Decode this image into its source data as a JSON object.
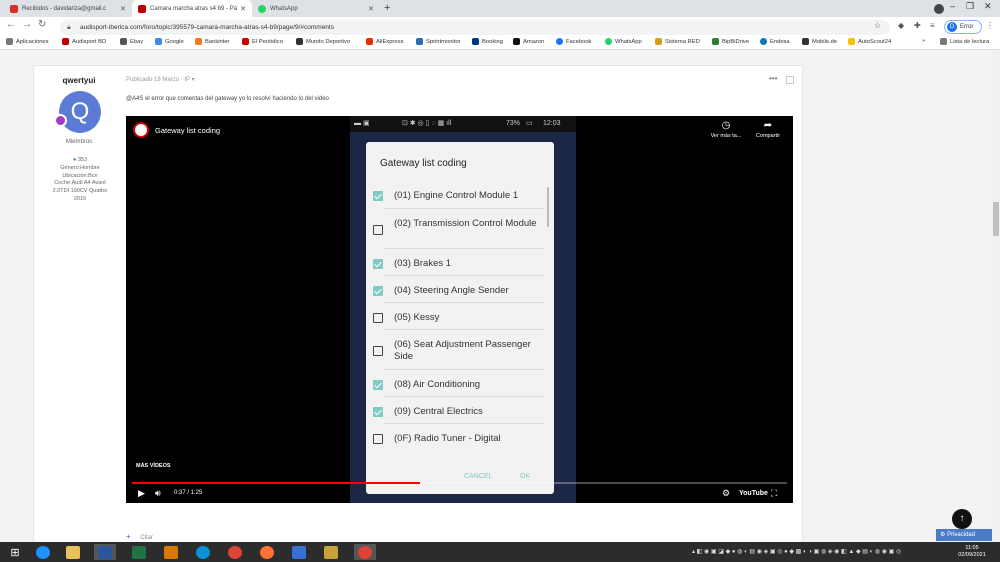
{
  "browser": {
    "tabs": [
      {
        "label": "Recibidos - davidariza@gmail.c",
        "icon": "gmail-icon",
        "color": "#d93025",
        "active": false
      },
      {
        "label": "Camara marcha atras s4 b9 - Pá",
        "icon": "audisport-icon",
        "color": "#c00000",
        "active": true
      },
      {
        "label": "WhatsApp",
        "icon": "whatsapp-icon",
        "color": "#25d366",
        "active": false
      }
    ],
    "url": "audisport-iberica.com/foro/topic/395579-camara-marcha-atras-s4-b9/page/9/#comments",
    "profile_label": "Error",
    "profile_initial": "D",
    "bookmarks": [
      {
        "label": "Aplicaciones",
        "color": "#777"
      },
      {
        "label": "Audisport BD",
        "color": "#c00000"
      },
      {
        "label": "Ebay",
        "color": "#555"
      },
      {
        "label": "Google",
        "color": "#4285f4"
      },
      {
        "label": "Bankinter",
        "color": "#f47920"
      },
      {
        "label": "El Periódico",
        "color": "#c00"
      },
      {
        "label": "Mundo Deportivo",
        "color": "#333"
      },
      {
        "label": "AliExpress",
        "color": "#e62e04"
      },
      {
        "label": "Sprintmonitor",
        "color": "#2b6cb0"
      },
      {
        "label": "Booking",
        "color": "#003580"
      },
      {
        "label": "Amazon",
        "color": "#111"
      },
      {
        "label": "Facebook",
        "color": "#1877f2"
      },
      {
        "label": "WhatsApp",
        "color": "#25d366"
      },
      {
        "label": "Sistema RED",
        "color": "#d4a017"
      },
      {
        "label": "BipBiDrive",
        "color": "#2e7d32"
      },
      {
        "label": "Endesa",
        "color": "#0b76bb"
      },
      {
        "label": "Mobile.de",
        "color": "#333"
      },
      {
        "label": "AutoScout24",
        "color": "#f5c400"
      }
    ],
    "more_bookmarks": "»",
    "reading_list": "Lista de lectura"
  },
  "post": {
    "author": "qwertyui",
    "avatar_letter": "Q",
    "role": "Miembros",
    "stats_lines": [
      "353",
      "Género:Hombre",
      "Ubicación:Bcn",
      "Coche:Audi A4 Avant",
      "2.0TDI 190CV Quattro",
      "2016"
    ],
    "meta": "Publicado 18 Marzo · IP ▾",
    "menu": "•••",
    "text": "@A4S el error que comentas del gateway yo lo resolví haciendo lo del video",
    "reply_label": "Citar"
  },
  "video": {
    "title": "Gateway list coding",
    "watch_later": "Ver más ta...",
    "share": "Compartir",
    "phone_status_battery": "73%",
    "phone_status_time": "12:03",
    "more_videos": "MÁS VÍDEOS",
    "time": "0:37 / 1:25",
    "progress": 0.44,
    "buffer": 0.39,
    "brand": "YouTube"
  },
  "dialog": {
    "title": "Gateway list coding",
    "items": [
      {
        "label": "(01) Engine Control Module 1",
        "checked": true
      },
      {
        "label": "(02) Transmission Control Module",
        "checked": false
      },
      {
        "label": "(03) Brakes 1",
        "checked": true
      },
      {
        "label": "(04) Steering Angle Sender",
        "checked": true
      },
      {
        "label": "(05) Kessy",
        "checked": false
      },
      {
        "label": "(06) Seat Adjustment Passenger Side",
        "checked": false
      },
      {
        "label": "(08) Air Conditioning",
        "checked": true
      },
      {
        "label": "(09) Central Electrics",
        "checked": true
      },
      {
        "label": "(0F) Radio Tuner - Digital",
        "checked": false
      }
    ],
    "cancel": "CANCEL",
    "ok": "OK"
  },
  "overlay": {
    "privacy": "Privacidad"
  },
  "taskbar": {
    "apps": [
      {
        "name": "edge-legacy",
        "color": "#1e90ff"
      },
      {
        "name": "file-explorer",
        "color": "#e8c15a"
      },
      {
        "name": "word",
        "color": "#2b579a"
      },
      {
        "name": "excel",
        "color": "#217346"
      },
      {
        "name": "outlook",
        "color": "#d97a00"
      },
      {
        "name": "edge",
        "color": "#0c8fd4"
      },
      {
        "name": "chrome",
        "color": "#db4437"
      },
      {
        "name": "firefox",
        "color": "#ff7139"
      },
      {
        "name": "uploader",
        "color": "#3b6fd8"
      },
      {
        "name": "media",
        "color": "#c7a33a"
      },
      {
        "name": "chrome-active",
        "color": "#db4437"
      }
    ],
    "time": "11:05",
    "date": "02/09/2021"
  }
}
